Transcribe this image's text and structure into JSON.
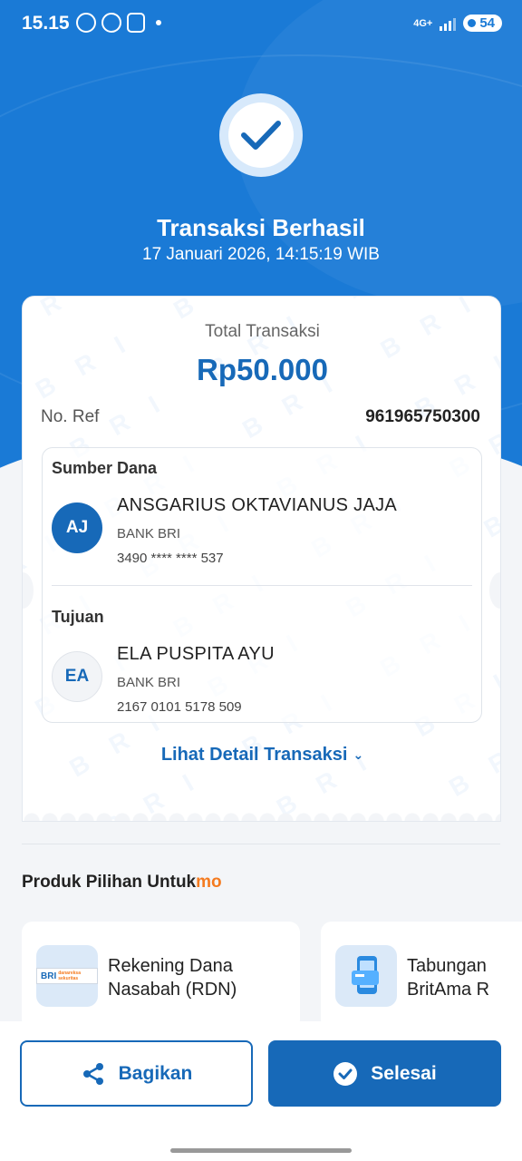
{
  "status_bar": {
    "time": "15.15",
    "network": "4G+",
    "battery": "54"
  },
  "result": {
    "title": "Transaksi Berhasil",
    "datetime": "17 Januari 2026, 14:15:19 WIB"
  },
  "receipt": {
    "total_label": "Total Transaksi",
    "total_amount": "Rp50.000",
    "ref_label": "No. Ref",
    "ref_value": "961965750300",
    "watermark": "BRI",
    "source": {
      "section_label": "Sumber Dana",
      "initials": "AJ",
      "name": "ANSGARIUS OKTAVIANUS JAJA",
      "bank": "BANK BRI",
      "account": "3490 **** **** 537"
    },
    "destination": {
      "section_label": "Tujuan",
      "initials": "EA",
      "name": "ELA PUSPITA AYU",
      "bank": "BANK BRI",
      "account": "2167 0101 5178 509"
    },
    "detail_link": "Lihat Detail Transaksi"
  },
  "products": {
    "title_main": "Produk Pilihan Untuk",
    "title_accent": "mo",
    "items": [
      {
        "label": "Rekening Dana\nNasabah (RDN)",
        "icon": "bri-danareksa-logo",
        "logo_text": "BRI",
        "logo_sub": "danareksa sekuritas"
      },
      {
        "label": "Tabungan\nBritAma R",
        "icon": "mobile-card-icon"
      }
    ]
  },
  "actions": {
    "share_label": "Bagikan",
    "done_label": "Selesai"
  },
  "colors": {
    "primary": "#1769b8",
    "hero": "#1a7ad6",
    "accent": "#f47b20"
  }
}
